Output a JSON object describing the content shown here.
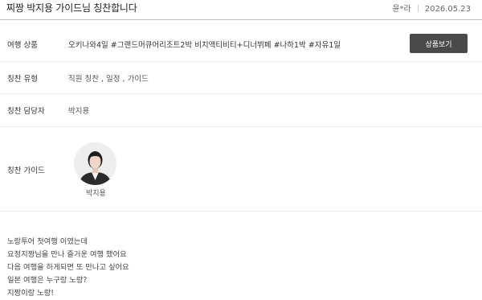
{
  "header": {
    "title": "찌짱 박지용 가이드님 칭찬합니다",
    "author": "윤*라",
    "date": "2026.05.23"
  },
  "fields": {
    "product": {
      "label": "여행 상품",
      "value": "오키나와4일 #그랜드머큐어리조트2박 비치액티비티+디너뷔페 #나하1박 #자유1일"
    },
    "type": {
      "label": "칭찬 유형",
      "value": "직원 칭찬 , 일정 , 가이드"
    },
    "staff": {
      "label": "칭찬 담당자",
      "value": "박지용"
    },
    "guide": {
      "label": "칭찬 가이드",
      "name": "박지용"
    }
  },
  "buttons": {
    "view_product": "상품보기"
  },
  "review_lines": [
    "노랑투어 첫여행 이였는데",
    "요정지짱님을 만나 즐거운 여행 했어요",
    "다음 여행을 하게되면 또 만나고 싶어요",
    "일본 여행은 누구랑 노랑?",
    "지짱이랑 노랑!"
  ]
}
